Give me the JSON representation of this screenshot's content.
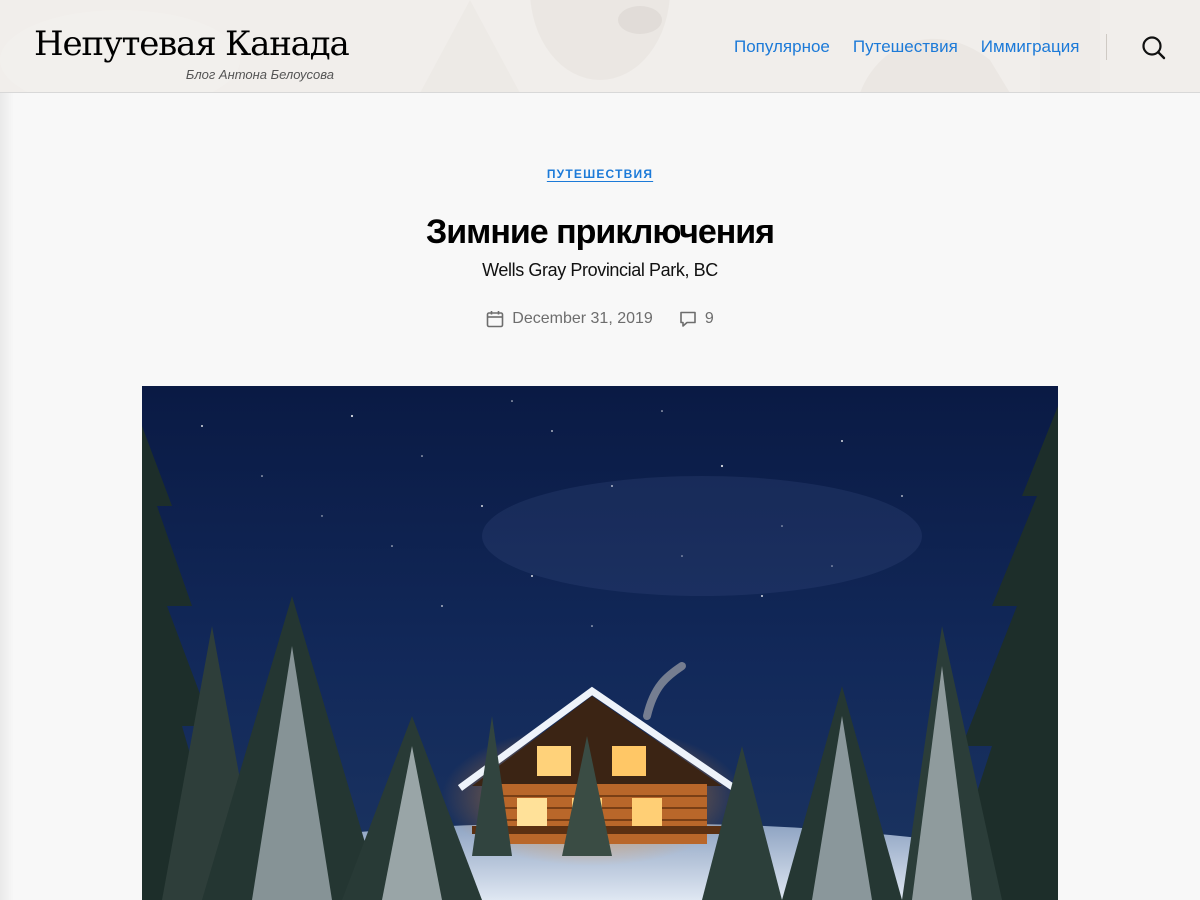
{
  "site": {
    "title": "Непутевая Канада",
    "tagline": "Блог Антона Белоусова"
  },
  "nav": {
    "items": [
      {
        "label": "Популярное"
      },
      {
        "label": "Путешествия"
      },
      {
        "label": "Иммиграция"
      }
    ],
    "search_icon": "search-icon"
  },
  "post": {
    "category": "ПУТЕШЕСТВИЯ",
    "title": "Зимние приключения",
    "subtitle": "Wells Gray Provincial Park, BC",
    "date": "December 31, 2019",
    "comments": "9",
    "date_icon": "calendar-icon",
    "comments_icon": "comment-icon"
  },
  "featured_image": {
    "subject": "winter-cabin-night"
  },
  "colors": {
    "accent": "#1c7ad8",
    "background": "#f8f8f8",
    "meta_text": "#6d6d6d"
  }
}
